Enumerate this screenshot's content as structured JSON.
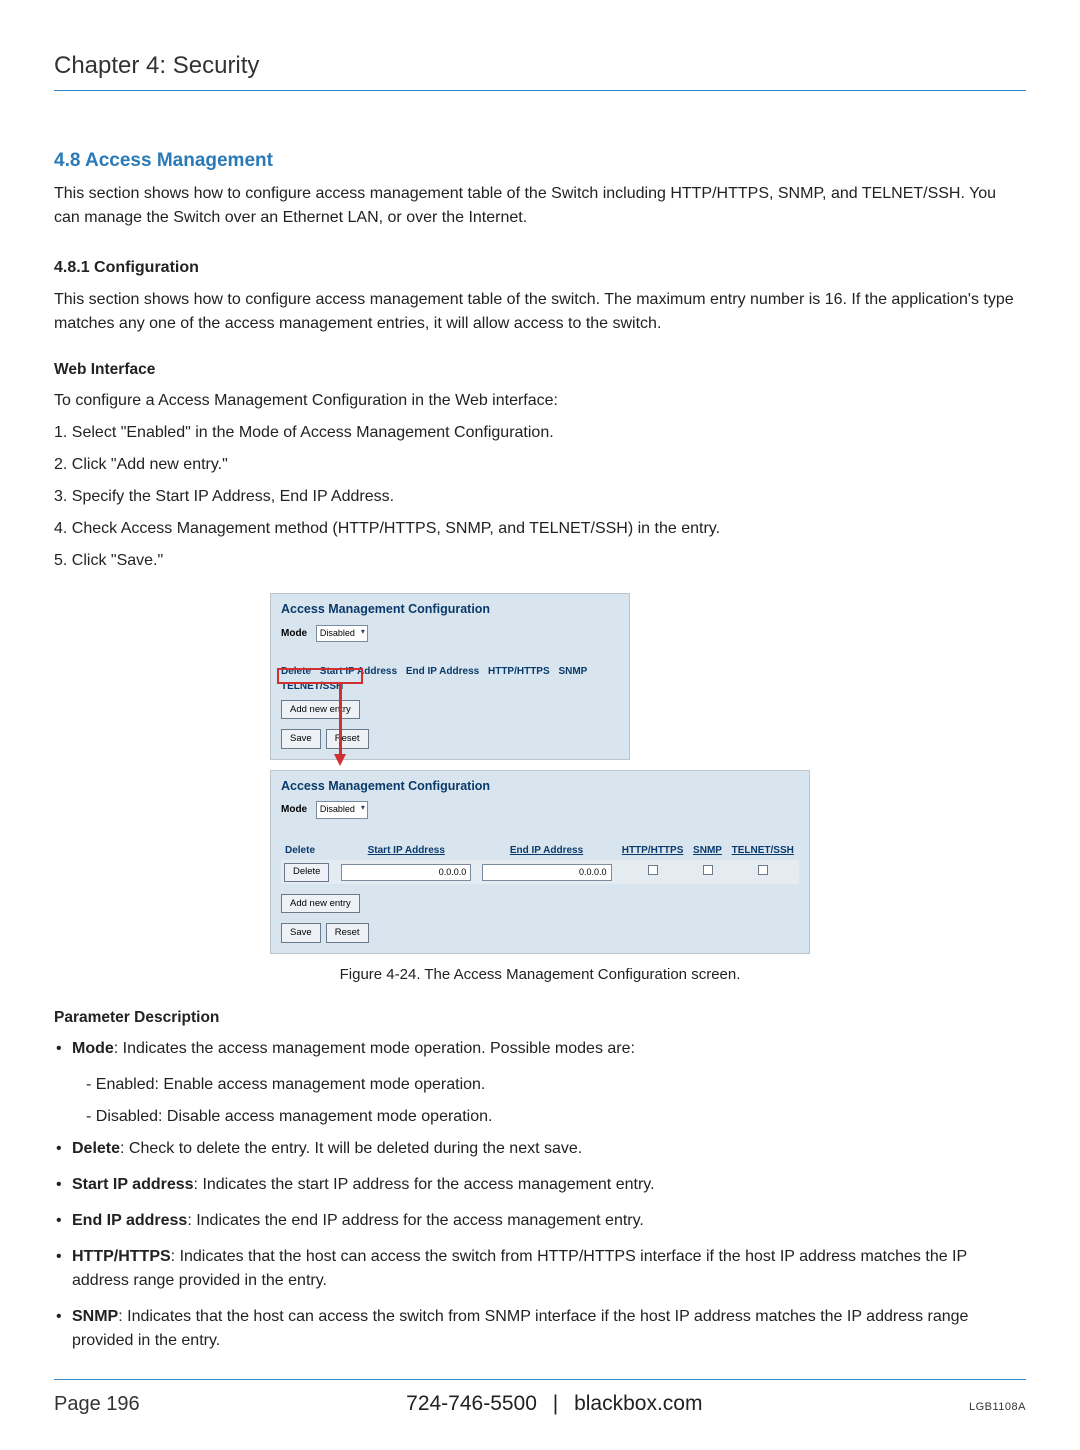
{
  "chapter": {
    "title": "Chapter 4: Security"
  },
  "section": {
    "heading": "4.8 Access Management",
    "intro": "This section shows how to configure access management table of the Switch including HTTP/HTTPS, SNMP, and TELNET/SSH. You can manage the Switch over an Ethernet LAN, or over the Internet."
  },
  "subsection": {
    "heading": "4.8.1 Configuration",
    "body": "This section shows how to configure access management table of the switch. The maximum entry number is 16. If the application's type matches any one of the access management entries, it will allow access to the switch."
  },
  "webiface": {
    "heading": "Web Interface",
    "intro": "To configure a Access Management Configuration in the Web interface:",
    "steps": [
      "1. Select \"Enabled\" in the Mode of Access Management Configuration.",
      "2. Click \"Add new entry.\"",
      "3. Specify the Start IP Address, End IP Address.",
      "4. Check Access Management method (HTTP/HTTPS, SNMP, and TELNET/SSH) in the entry.",
      "5. Click \"Save.\""
    ]
  },
  "screenshot": {
    "title": "Access Management Configuration",
    "mode_label": "Mode",
    "mode_value": "Disabled",
    "cols": {
      "delete": "Delete",
      "start_ip": "Start IP Address",
      "end_ip": "End IP Address",
      "http": "HTTP/HTTPS",
      "snmp": "SNMP",
      "telnet": "TELNET/SSH"
    },
    "add_label": "Add new entry",
    "save_label": "Save",
    "reset_label": "Reset",
    "delete_btn": "Delete",
    "ip_default": "0.0.0.0"
  },
  "figure_caption": "Figure 4-24. The Access Management Configuration screen.",
  "params": {
    "heading": "Parameter Description",
    "items": {
      "mode": {
        "label": "Mode",
        "text": ": Indicates the access management mode operation. Possible modes are:",
        "sub_enabled": "- Enabled: Enable access management mode operation.",
        "sub_disabled": "- Disabled: Disable access management mode operation."
      },
      "delete": {
        "label": "Delete",
        "text": ": Check to delete the entry. It will be deleted during the next save."
      },
      "startip": {
        "label": "Start IP address",
        "text": ": Indicates the start IP address for the access management entry."
      },
      "endip": {
        "label": "End IP address",
        "text": ": Indicates the end IP address for the access management entry."
      },
      "http": {
        "label": "HTTP/HTTPS",
        "text": ": Indicates that the host can access the switch from HTTP/HTTPS interface if the host IP address matches the IP address range provided in the entry."
      },
      "snmp": {
        "label": "SNMP",
        "text": ": Indicates that the host can access the switch from SNMP interface if the host IP address matches the IP address range provided in the entry."
      }
    }
  },
  "footer": {
    "page": "Page 196",
    "phone": "724-746-5500",
    "site": "blackbox.com",
    "model": "LGB1108A"
  }
}
